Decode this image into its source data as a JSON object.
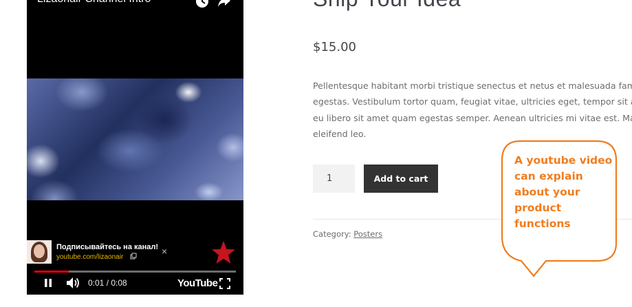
{
  "video": {
    "title": "Lizaonair Channel Intro",
    "channel_name": "Подписывайтесь на канал!",
    "channel_link": "youtube.com/lizaonair",
    "close_label": "×",
    "time": "0:01 / 0:08",
    "progress_fraction": 0.17,
    "logo_text": "YouTube",
    "icons": [
      "clock-icon",
      "share-icon",
      "external-link-icon",
      "star-icon",
      "pause-icon",
      "volume-icon",
      "fullscreen-icon"
    ]
  },
  "product": {
    "title": "Ship Your Idea",
    "price": "$15.00",
    "description_lines": [
      "Pellentesque habitant morbi tristique senectus et netus et malesuada fames ac",
      "egestas. Vestibulum tortor quam, feugiat vitae, ultricies eget, tempor sit amet,",
      "eu libero sit amet quam egestas semper. Aenean ultricies mi vitae est. Mauris p",
      "eleifend leo."
    ],
    "quantity": "1",
    "add_to_cart_label": "Add to cart",
    "category_label": "Category:",
    "category_value": "Posters"
  },
  "callout": {
    "text": "A youtube video can explain about your product functions",
    "color": "#ef7d1f"
  },
  "colors": {
    "button_bg": "#333333",
    "progress_red": "#e00000",
    "star_red": "#c4161c"
  }
}
